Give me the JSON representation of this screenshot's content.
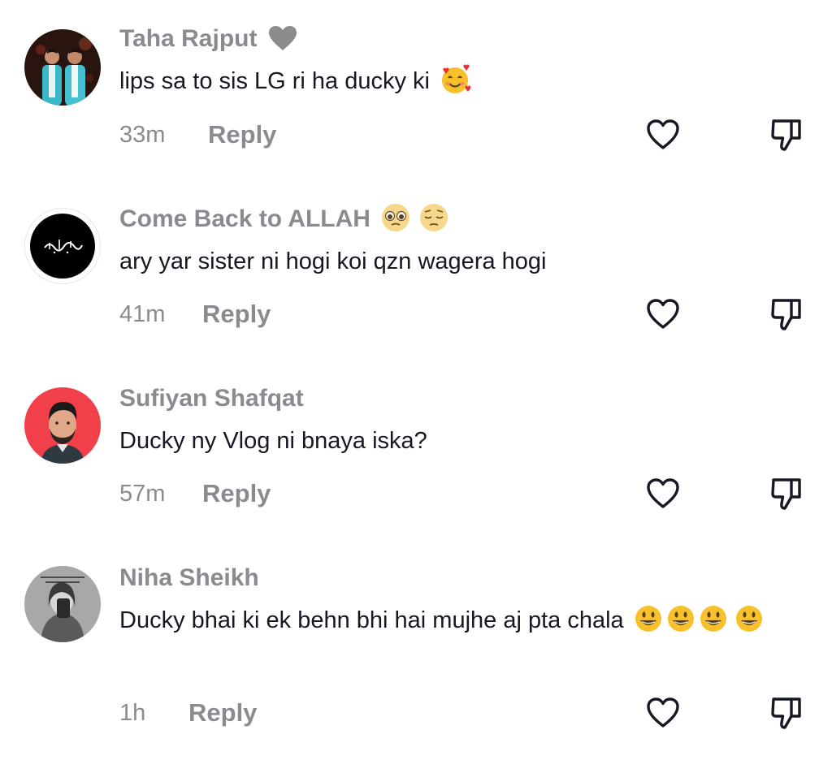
{
  "comments": [
    {
      "username": "Taha Rajput",
      "username_badge_icon": "grey-heart-icon",
      "text": "lips sa to sis LG ri ha ducky ki",
      "text_emojis": [
        "smiling-face-with-hearts-icon"
      ],
      "time": "33m",
      "reply_label": "Reply",
      "avatar_icon": "avatar-two-men-turquoise"
    },
    {
      "username": "Come Back to ALLAH",
      "username_badge_icons": [
        "pleading-face-icon",
        "pensive-face-icon"
      ],
      "text": "ary yar sister ni hogi koi qzn wagera hogi",
      "time": "41m",
      "reply_label": "Reply",
      "avatar_icon": "avatar-black-calligraphy"
    },
    {
      "username": "Sufiyan Shafqat",
      "text": "Ducky ny Vlog ni bnaya iska?",
      "time": "57m",
      "reply_label": "Reply",
      "avatar_icon": "avatar-bearded-man-red"
    },
    {
      "username": "Niha Sheikh",
      "text": "Ducky bhai ki ek behn bhi hai mujhe aj pta chala",
      "text_emojis": [
        "grinning-face-icon",
        "grinning-face-icon",
        "grinning-face-icon",
        "grinning-face-icon"
      ],
      "time": "1h",
      "reply_label": "Reply",
      "avatar_icon": "avatar-grey-mirror-selfie"
    }
  ],
  "colors": {
    "secondary_text": "#8a8b91",
    "primary_text": "#161823",
    "background": "#ffffff"
  }
}
